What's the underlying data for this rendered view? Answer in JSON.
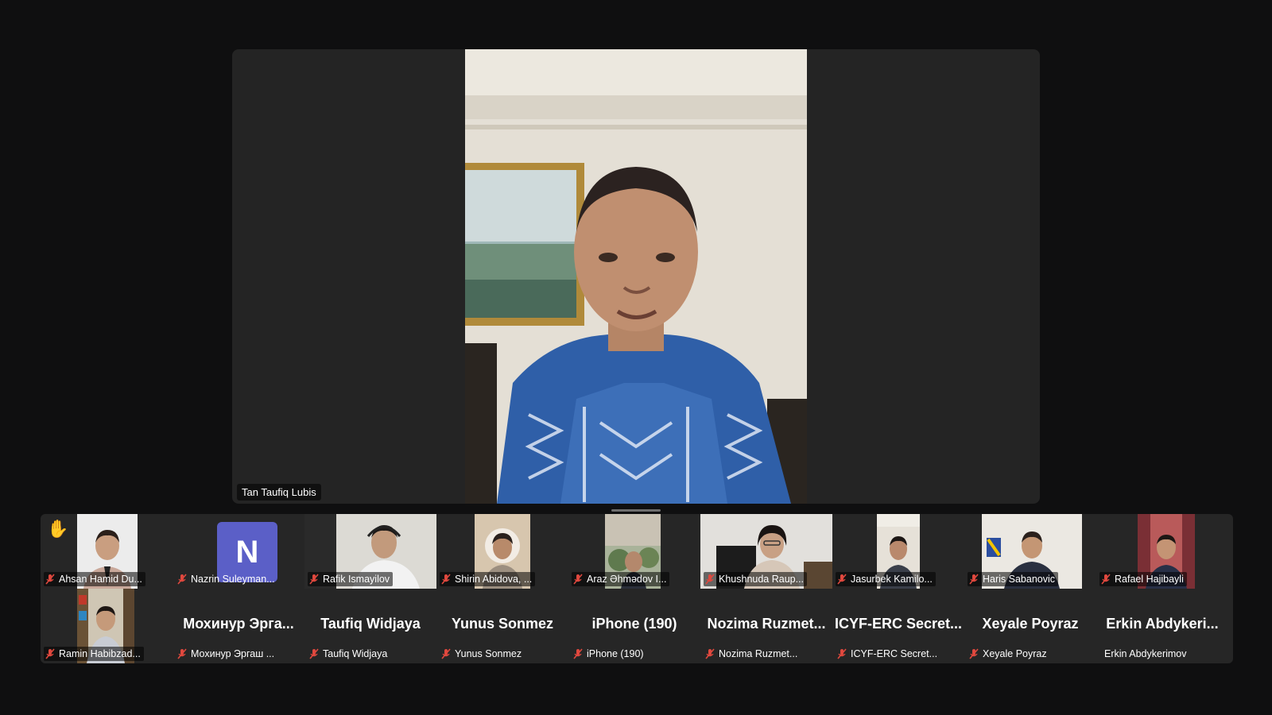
{
  "speaker": {
    "name": "Tan Taufiq Lubis"
  },
  "raised_hand_icon": "raised-hand-icon",
  "mic_icon": "muted-mic-icon",
  "colors": {
    "muted": "#e0483e",
    "avatar_bg": "#5b5fc7",
    "hand": "#f4c542"
  },
  "row1": [
    {
      "label": "Ahsan Hamid Du...",
      "muted": true
    },
    {
      "label": "Nazrin Suleyman...",
      "muted": true,
      "avatar": "N"
    },
    {
      "label": "Rafik Ismayilov",
      "muted": true
    },
    {
      "label": "Shirin Abidova, ...",
      "muted": true
    },
    {
      "label": "Araz Əhmədov I...",
      "muted": true
    },
    {
      "label": "Khushnuda Raup...",
      "muted": true
    },
    {
      "label": "Jasurbek Kamilo...",
      "muted": true
    },
    {
      "label": "Haris Sabanovic",
      "muted": true
    },
    {
      "label": "Rafael Hajibayli",
      "muted": true
    }
  ],
  "row2": [
    {
      "label": "Ramin Habibzad...",
      "muted": true
    },
    {
      "big": "Мохинур Эргa...",
      "label": "Мохинур Эргаш ...",
      "muted": true
    },
    {
      "big": "Taufiq Widjaya",
      "label": "Taufiq Widjaya",
      "muted": true
    },
    {
      "big": "Yunus Sonmez",
      "label": "Yunus Sonmez",
      "muted": true
    },
    {
      "big": "iPhone (190)",
      "label": "iPhone (190)",
      "muted": true
    },
    {
      "big": "Nozima  Ruzmet...",
      "label": "Nozima Ruzmet...",
      "muted": true
    },
    {
      "big": "ICYF-ERC  Secret...",
      "label": "ICYF-ERC Secret...",
      "muted": true
    },
    {
      "big": "Xeyale Poyraz",
      "label": "Xeyale Poyraz",
      "muted": true
    },
    {
      "big": "Erkin  Abdykeri...",
      "label": "Erkin Abdykerimov",
      "muted": false
    }
  ]
}
